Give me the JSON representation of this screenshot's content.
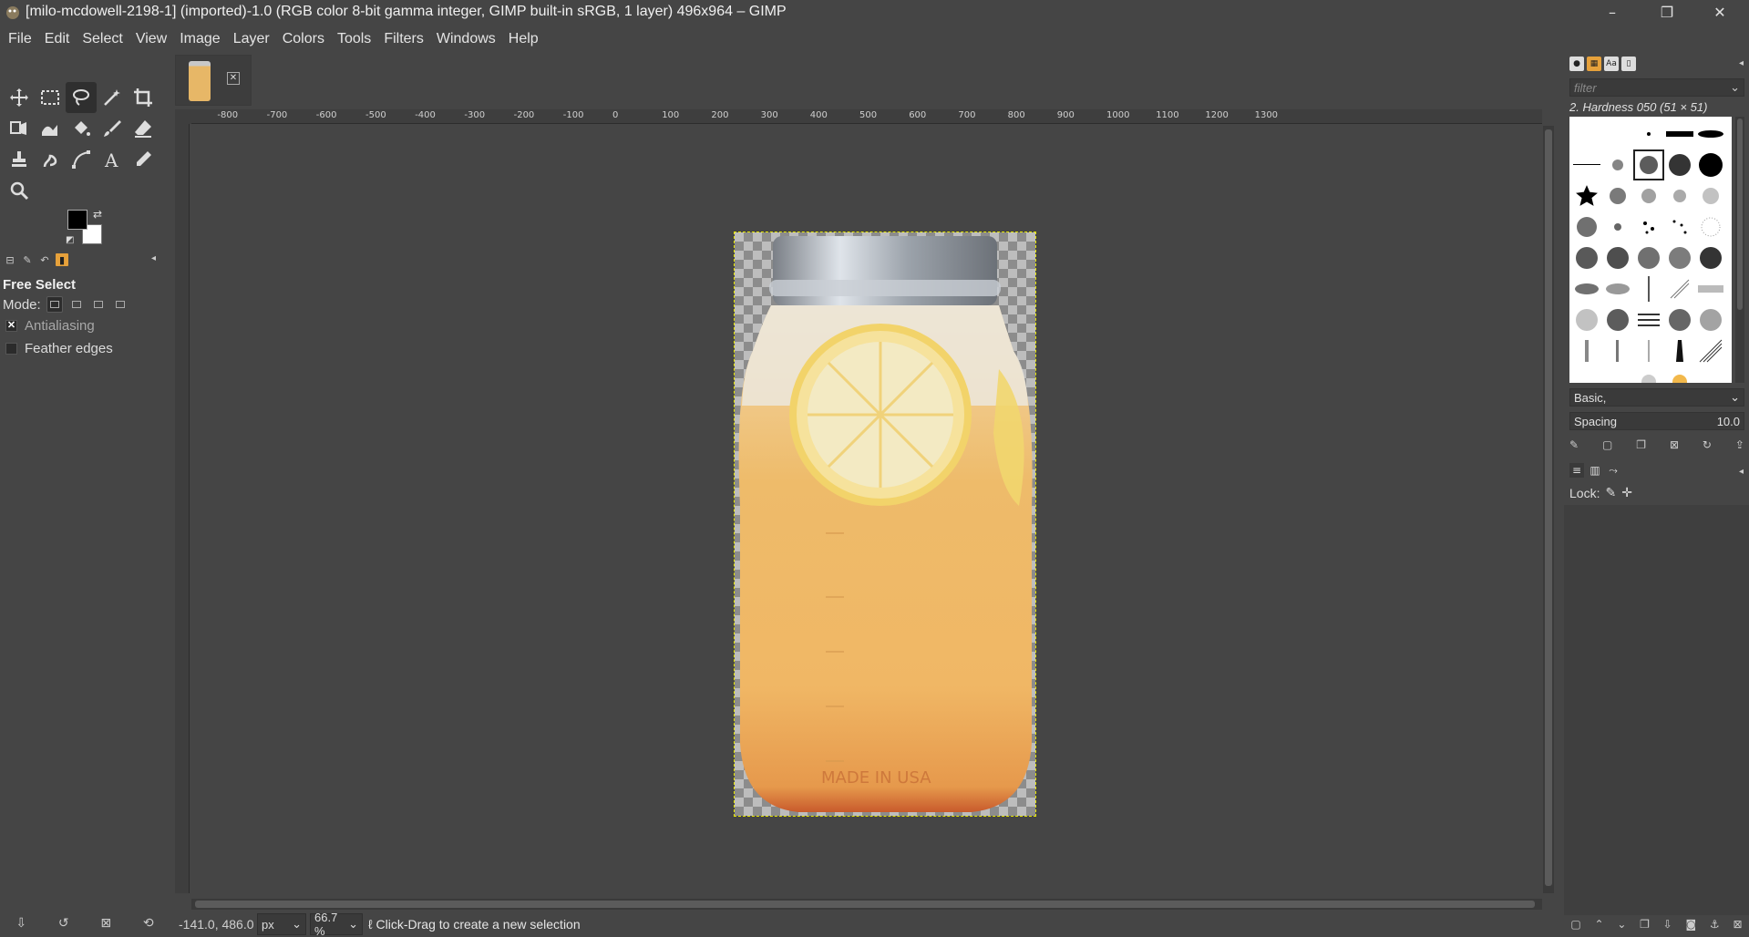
{
  "window": {
    "title": "[milo-mcdowell-2198-1] (imported)-1.0 (RGB color 8-bit gamma integer, GIMP built-in sRGB, 1 layer) 496x964 – GIMP",
    "minimize": "–",
    "maximize": "❐",
    "close": "✕"
  },
  "menu": [
    "File",
    "Edit",
    "Select",
    "View",
    "Image",
    "Layer",
    "Colors",
    "Tools",
    "Filters",
    "Windows",
    "Help"
  ],
  "tool_options": {
    "title": "Free Select",
    "mode_label": "Mode:",
    "antialiasing": "Antialiasing",
    "feather": "Feather edges"
  },
  "ruler": {
    "h_labels": [
      "-800",
      "-700",
      "-600",
      "-500",
      "-400",
      "-300",
      "-200",
      "-100",
      "0",
      "100",
      "200",
      "300",
      "400",
      "500",
      "600",
      "700",
      "800",
      "900",
      "1000",
      "1100",
      "1200",
      "1300"
    ]
  },
  "status": {
    "coords": "-141.0, 486.0",
    "unit": "px",
    "zoom": "66.7 %",
    "message": "Click-Drag to create a new selection"
  },
  "brushes": {
    "filter_placeholder": "filter",
    "selected_name": "2. Hardness 050 (51 × 51)",
    "preset": "Basic,",
    "spacing_label": "Spacing",
    "spacing_value": "10.0"
  },
  "layers": {
    "lock_label": "Lock:"
  },
  "colors": {
    "fg": "#000000",
    "bg": "#ffffff",
    "accent": "#e6a13b",
    "selection": "#e8e800"
  }
}
